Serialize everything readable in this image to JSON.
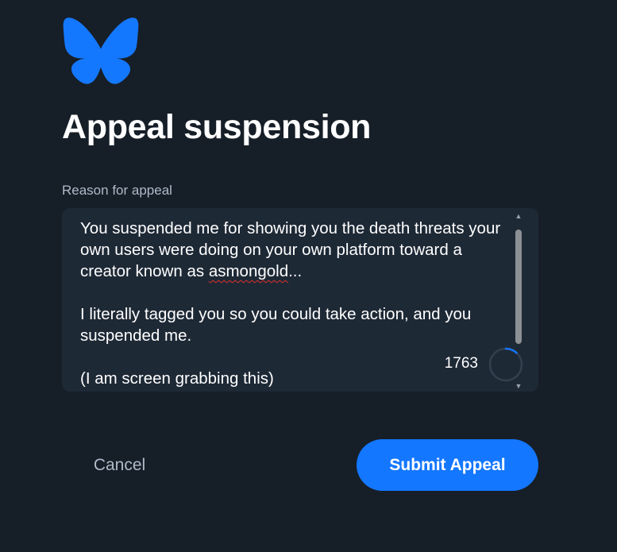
{
  "logo": {
    "icon": "butterfly-icon",
    "color": "#1478ff"
  },
  "title": "Appeal suspension",
  "form": {
    "label": "Reason for appeal",
    "paragraphs": [
      {
        "before": "You suspended me for showing you the death threats your own users were doing on your own platform toward a creator known as ",
        "misspelled": "asmongold",
        "after": "..."
      },
      {
        "text": "I literally tagged you so you could take action, and you suspended me."
      },
      {
        "text": "(I am screen grabbing this)"
      }
    ],
    "remaining_chars": "1763",
    "usage_fraction": 0.1186
  },
  "buttons": {
    "cancel": "Cancel",
    "submit": "Submit Appeal"
  },
  "colors": {
    "background": "#161e27",
    "field_background": "#1e2936",
    "accent": "#1477ff",
    "muted_text": "#aebbc9",
    "spellcheck_underline": "#e0302c"
  }
}
